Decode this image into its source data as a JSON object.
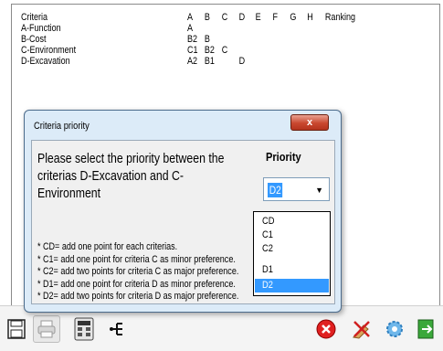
{
  "matrix": {
    "header": [
      "Criteria",
      "A",
      "B",
      "C",
      "D",
      "E",
      "F",
      "G",
      "H",
      "Ranking"
    ],
    "rows": [
      {
        "label": "A-Function",
        "cells": [
          "A"
        ]
      },
      {
        "label": "B-Cost",
        "cells": [
          "B2",
          "B"
        ]
      },
      {
        "label": "C-Environment",
        "cells": [
          "C1",
          "B2",
          "C"
        ]
      },
      {
        "label": "D-Excavation",
        "cells": [
          "A2",
          "B1",
          "",
          "D"
        ]
      }
    ]
  },
  "dialog": {
    "title": "Criteria priority",
    "close_label": "x",
    "prompt": "Please select the priority between the criterias D-Excavation and C-Environment",
    "priority_label": "Priority",
    "selected_value": "D2",
    "options": [
      "CD",
      "C1",
      "C2",
      "D1",
      "D2"
    ],
    "notes": [
      "* CD= add one point for each criterias.",
      "* C1= add one point for criteria C as minor preference.",
      "* C2= add two points for criteria C as major preference.",
      "* D1= add one point for criteria D as minor preference.",
      "* D2= add two points for criteria D as major preference."
    ]
  },
  "toolbar": {
    "left_icons": [
      "save-icon",
      "print-icon",
      "calculator-icon",
      "hierarchy-icon"
    ],
    "right_icons": [
      "cancel-icon",
      "clear-icon",
      "settings-icon",
      "exit-icon"
    ]
  }
}
